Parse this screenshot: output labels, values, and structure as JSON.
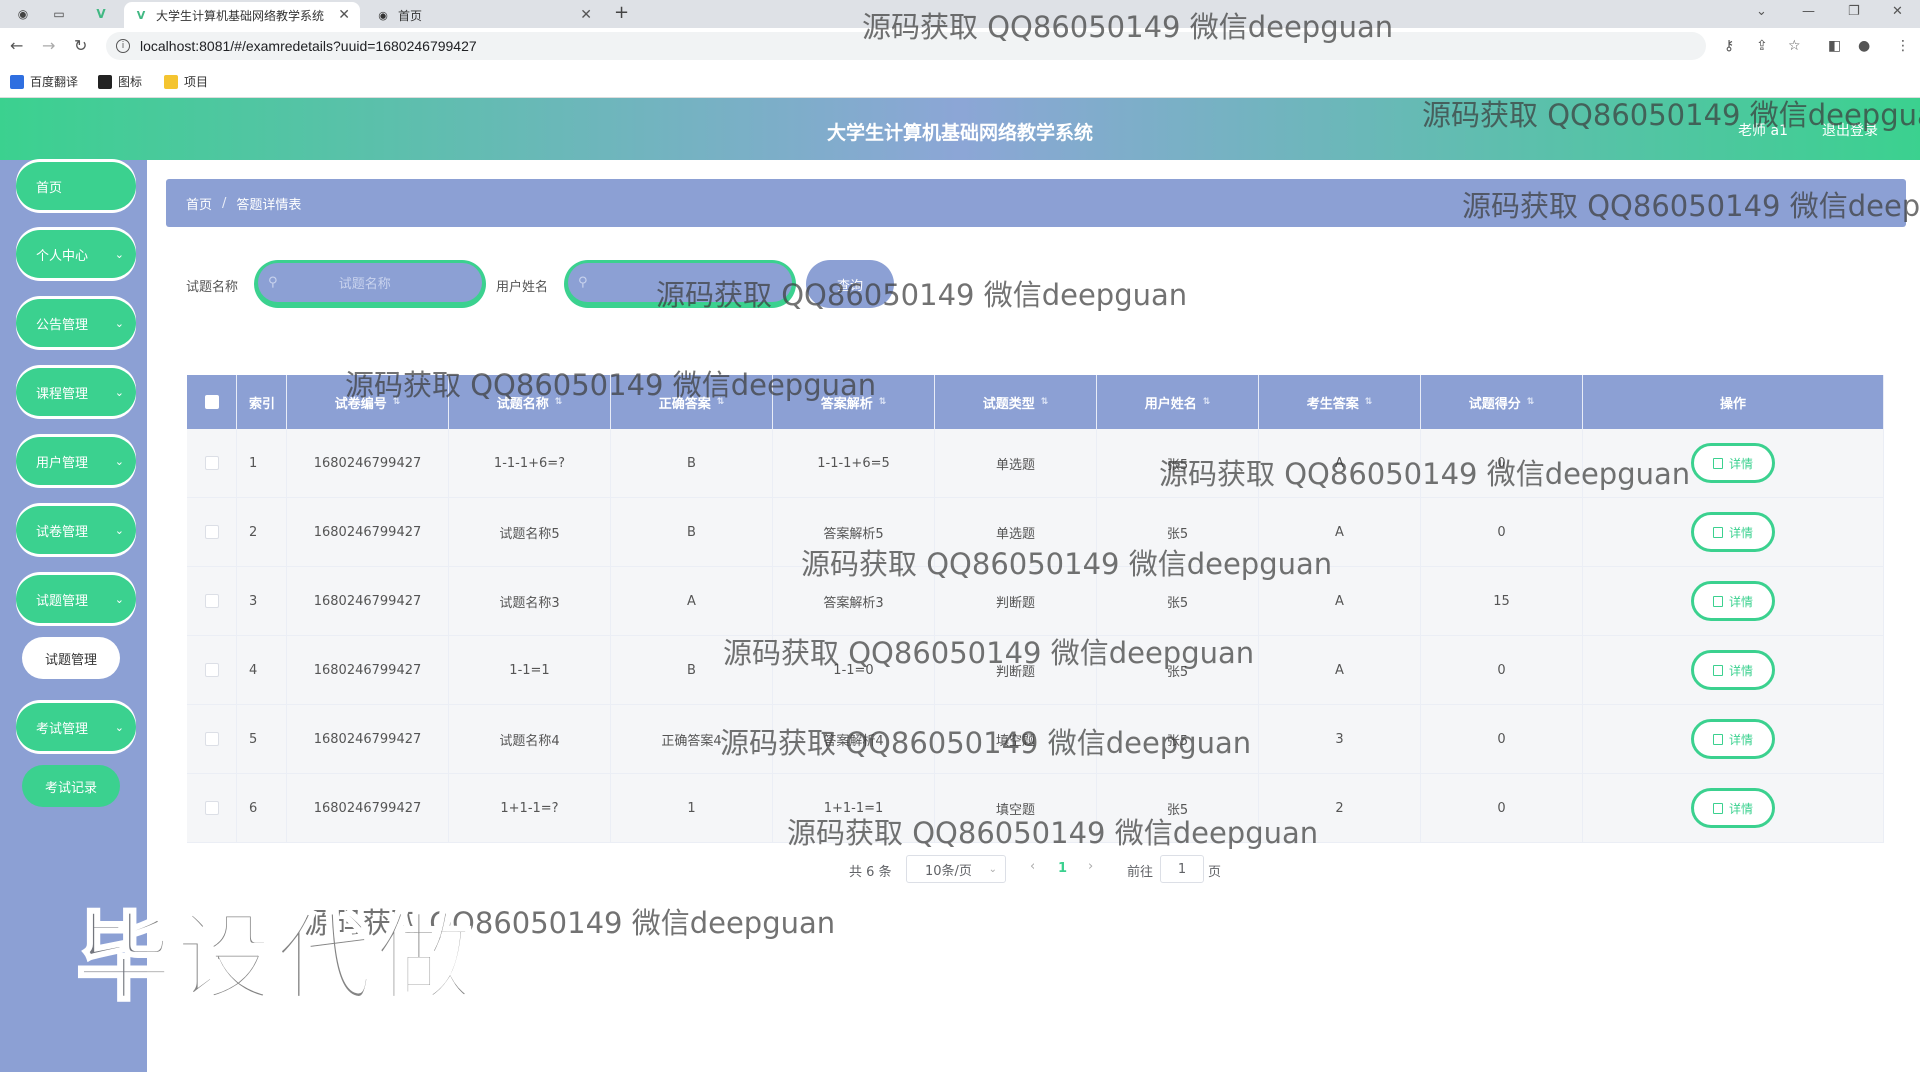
{
  "browser": {
    "tabs": [
      {
        "title": "大学生计算机基础网络教学系统",
        "active": true
      },
      {
        "title": "首页",
        "active": false
      }
    ],
    "url": "localhost:8081/#/examredetails?uuid=1680246799427",
    "bookmarks": [
      {
        "label": "百度翻译",
        "color": "#2f6fe0"
      },
      {
        "label": "图标",
        "color": "#222222"
      },
      {
        "label": "项目",
        "color": "#f4c430"
      }
    ]
  },
  "header": {
    "title": "大学生计算机基础网络教学系统",
    "user": "老师 a1",
    "logout": "退出登录"
  },
  "sidebar": {
    "items": [
      {
        "label": "首页",
        "has_chevron": false
      },
      {
        "label": "个人中心",
        "has_chevron": true
      },
      {
        "label": "公告管理",
        "has_chevron": true
      },
      {
        "label": "课程管理",
        "has_chevron": true
      },
      {
        "label": "用户管理",
        "has_chevron": true
      },
      {
        "label": "试卷管理",
        "has_chevron": true
      },
      {
        "label": "试题管理",
        "has_chevron": true
      },
      {
        "label": "考试管理",
        "has_chevron": true
      }
    ],
    "sub_item_active": "试题管理",
    "sub_item_exam_record": "考试记录"
  },
  "breadcrumb": {
    "home": "首页",
    "separator": "/",
    "current": "答题详情表"
  },
  "search": {
    "field1_label": "试题名称",
    "field1_placeholder": "试题名称",
    "field2_label": "用户姓名",
    "field2_placeholder": "",
    "query_button": "查询"
  },
  "table": {
    "headers": [
      "索引",
      "试卷编号",
      "试题名称",
      "正确答案",
      "答案解析",
      "试题类型",
      "用户姓名",
      "考生答案",
      "试题得分",
      "操作"
    ],
    "rows": [
      {
        "index": "1",
        "paper_no": "1680246799427",
        "question": "1-1-1+6=?",
        "answer": "B",
        "analysis": "1-1-1+6=5",
        "type": "单选题",
        "user": "张5",
        "student_answer": "A",
        "score": "0"
      },
      {
        "index": "2",
        "paper_no": "1680246799427",
        "question": "试题名称5",
        "answer": "B",
        "analysis": "答案解析5",
        "type": "单选题",
        "user": "张5",
        "student_answer": "A",
        "score": "0"
      },
      {
        "index": "3",
        "paper_no": "1680246799427",
        "question": "试题名称3",
        "answer": "A",
        "analysis": "答案解析3",
        "type": "判断题",
        "user": "张5",
        "student_answer": "A",
        "score": "15"
      },
      {
        "index": "4",
        "paper_no": "1680246799427",
        "question": "1-1=1",
        "answer": "B",
        "analysis": "1-1=0",
        "type": "判断题",
        "user": "张5",
        "student_answer": "A",
        "score": "0"
      },
      {
        "index": "5",
        "paper_no": "1680246799427",
        "question": "试题名称4",
        "answer": "正确答案4",
        "analysis": "答案解析4",
        "type": "填空题",
        "user": "张5",
        "student_answer": "3",
        "score": "0"
      },
      {
        "index": "6",
        "paper_no": "1680246799427",
        "question": "1+1-1=?",
        "answer": "1",
        "analysis": "1+1-1=1",
        "type": "填空题",
        "user": "张5",
        "student_answer": "2",
        "score": "0"
      }
    ],
    "detail_button": "详情"
  },
  "pagination": {
    "total": "共 6 条",
    "page_size": "10条/页",
    "current_page": "1",
    "goto_prefix": "前往",
    "goto_value": "1",
    "goto_suffix": "页"
  },
  "watermarks": {
    "text": "源码获取 QQ86050149 微信deepguan",
    "big": "毕设代做"
  },
  "colors": {
    "accent_green": "#3bd18f",
    "periwinkle": "#8ca0d4"
  }
}
